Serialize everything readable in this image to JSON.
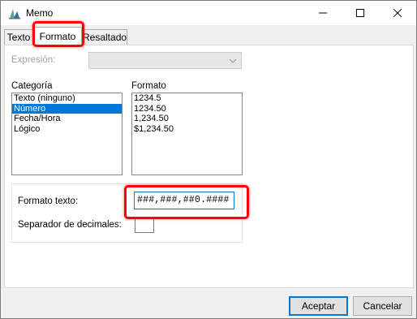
{
  "window": {
    "title": "Memo",
    "app_icon": "chart-logo-icon"
  },
  "tabs": [
    {
      "label": "Texto",
      "active": false
    },
    {
      "label": "Formato",
      "active": true
    },
    {
      "label": "Resaltado",
      "active": false
    }
  ],
  "expression": {
    "label": "Expresión:",
    "value": "",
    "enabled": false
  },
  "category": {
    "label": "Categoría",
    "items": [
      "Texto (ninguno)",
      "Número",
      "Fecha/Hora",
      "Lógico"
    ],
    "selected": "Número"
  },
  "format": {
    "label": "Formato",
    "items": [
      "1234.5",
      "1234.50",
      "1,234.50",
      "$1,234.50"
    ]
  },
  "format_text": {
    "label": "Formato texto:",
    "value": "###,###,##0.####"
  },
  "decimal_separator": {
    "label": "Separador de decimales:",
    "value": ""
  },
  "buttons": {
    "ok": "Aceptar",
    "cancel": "Cancelar"
  },
  "colors": {
    "accent": "#0078d7",
    "highlight": "#ff0000"
  }
}
